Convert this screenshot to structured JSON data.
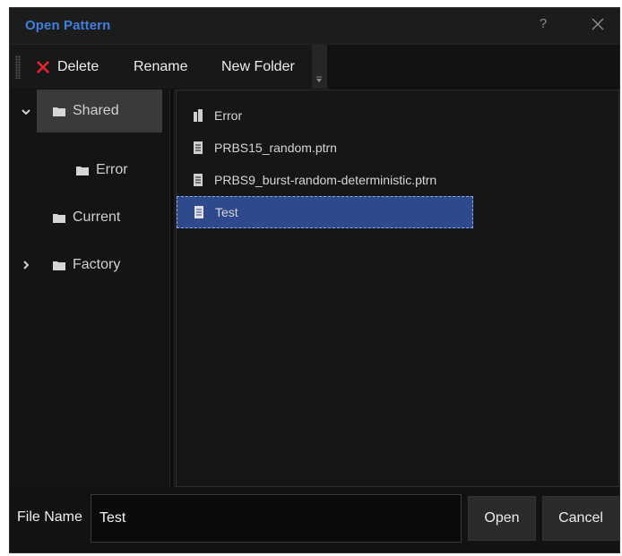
{
  "dialog": {
    "title": "Open Pattern",
    "help_glyph": "?",
    "icons": {
      "help": "help-icon",
      "close": "close-icon"
    }
  },
  "toolbar": {
    "delete_label": "Delete",
    "rename_label": "Rename",
    "new_folder_label": "New Folder",
    "delete_icon_color": "#e8262c"
  },
  "tree": {
    "shared": {
      "label": "Shared",
      "expanded": true,
      "selected": true
    },
    "error": {
      "label": "Error"
    },
    "current": {
      "label": "Current"
    },
    "factory": {
      "label": "Factory",
      "expanded": false
    }
  },
  "files": {
    "items": [
      {
        "name": "Error",
        "type": "folder"
      },
      {
        "name": "PRBS15_random.ptrn",
        "type": "file"
      },
      {
        "name": "PRBS9_burst-random-deterministic.ptrn",
        "type": "file"
      },
      {
        "name": "Test",
        "type": "file",
        "selected": true
      }
    ]
  },
  "footer": {
    "file_name_label": "File Name",
    "file_name_value": "Test",
    "open_label": "Open",
    "cancel_label": "Cancel"
  },
  "colors": {
    "accent": "#3f7fe0",
    "selection": "#2e4a8c",
    "background": "#121212"
  }
}
